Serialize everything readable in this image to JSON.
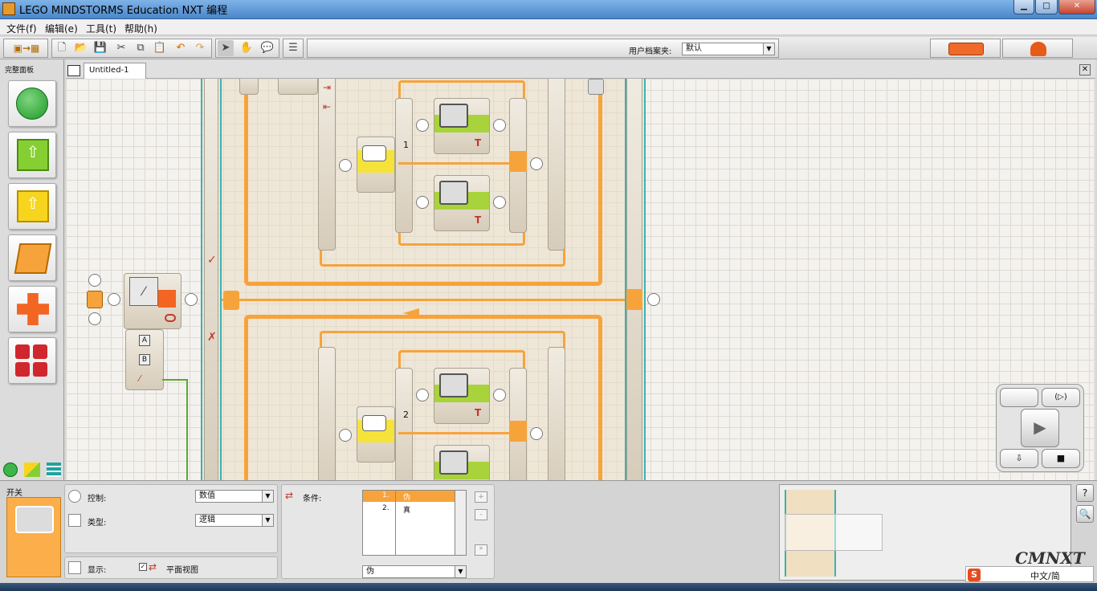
{
  "window": {
    "title": "LEGO MINDSTORMS Education NXT 编程"
  },
  "menu": {
    "items": [
      "文件(f)",
      "编辑(e)",
      "工具(t)",
      "帮助(h)"
    ]
  },
  "toolbar": {
    "profile_label": "用户档案夹:",
    "profile_value": "默认"
  },
  "palette": {
    "title": "完整面板"
  },
  "tabs": [
    {
      "label": "Untitled-1"
    }
  ],
  "program": {
    "case_1": "1",
    "case_2": "2",
    "compare_ports": [
      "A",
      "B"
    ]
  },
  "config": {
    "block_title": "开关",
    "control_label": "控制:",
    "control_value": "数值",
    "type_label": "类型:",
    "type_value": "逻辑",
    "display_label": "显示:",
    "flat_view_label": "平面视图",
    "conditions_label": "条件:",
    "conditions": [
      {
        "num": "1.",
        "value": "伪"
      },
      {
        "num": "2.",
        "value": "真"
      }
    ],
    "condition_select": "伪"
  },
  "watermark": "CMNXT",
  "ime": {
    "label": "中文/简"
  },
  "colors": {
    "accent": "#f7a33b",
    "connector": "#3bb3b0",
    "title_bar": "#4b86c9"
  }
}
